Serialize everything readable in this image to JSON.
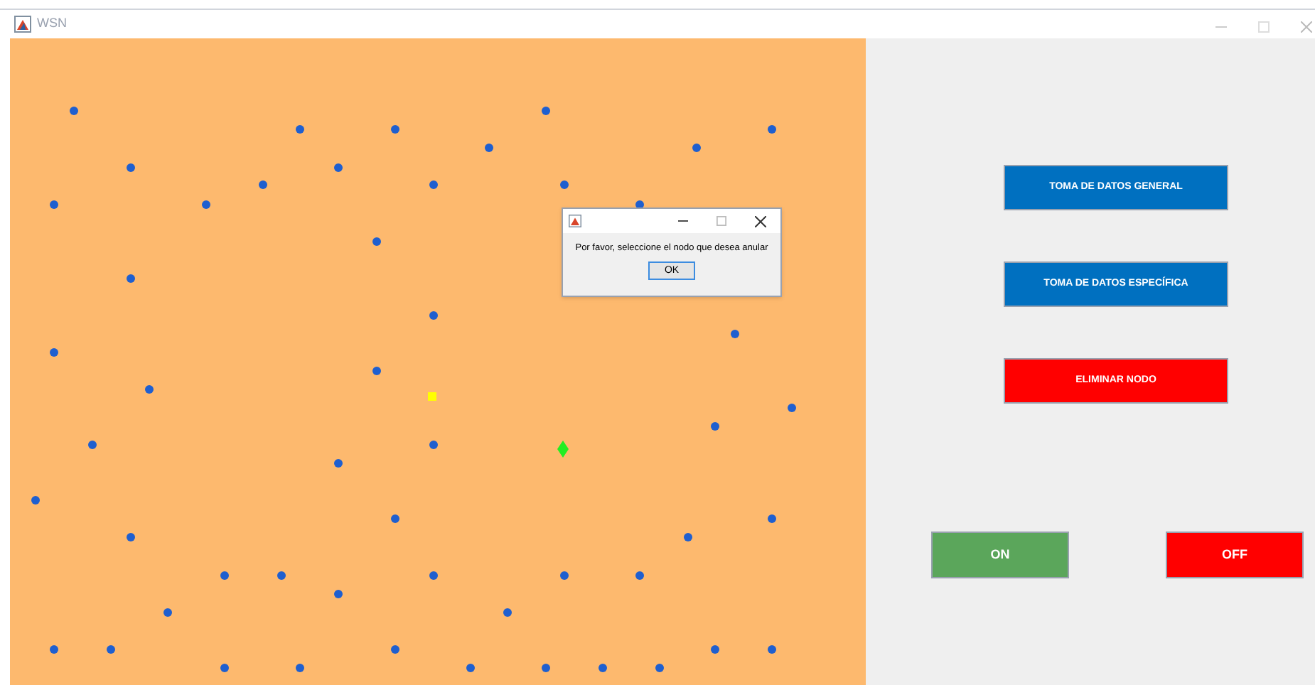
{
  "window": {
    "title": "WSN"
  },
  "dialog": {
    "message": "Por favor, seleccione el nodo que desea anular",
    "button": "OK"
  },
  "actions": [
    {
      "label": "TOMA DE DATOS GENERAL",
      "color": "#0070c0"
    },
    {
      "label": "TOMA DE DATOS ESPECÍFICA",
      "color": "#0070c0"
    },
    {
      "label": "ELIMINAR NODO",
      "color": "#ff0000"
    }
  ],
  "power": [
    {
      "label": "ON",
      "color": "#5ba65b"
    },
    {
      "label": "OFF",
      "color": "#ff0000"
    }
  ]
}
